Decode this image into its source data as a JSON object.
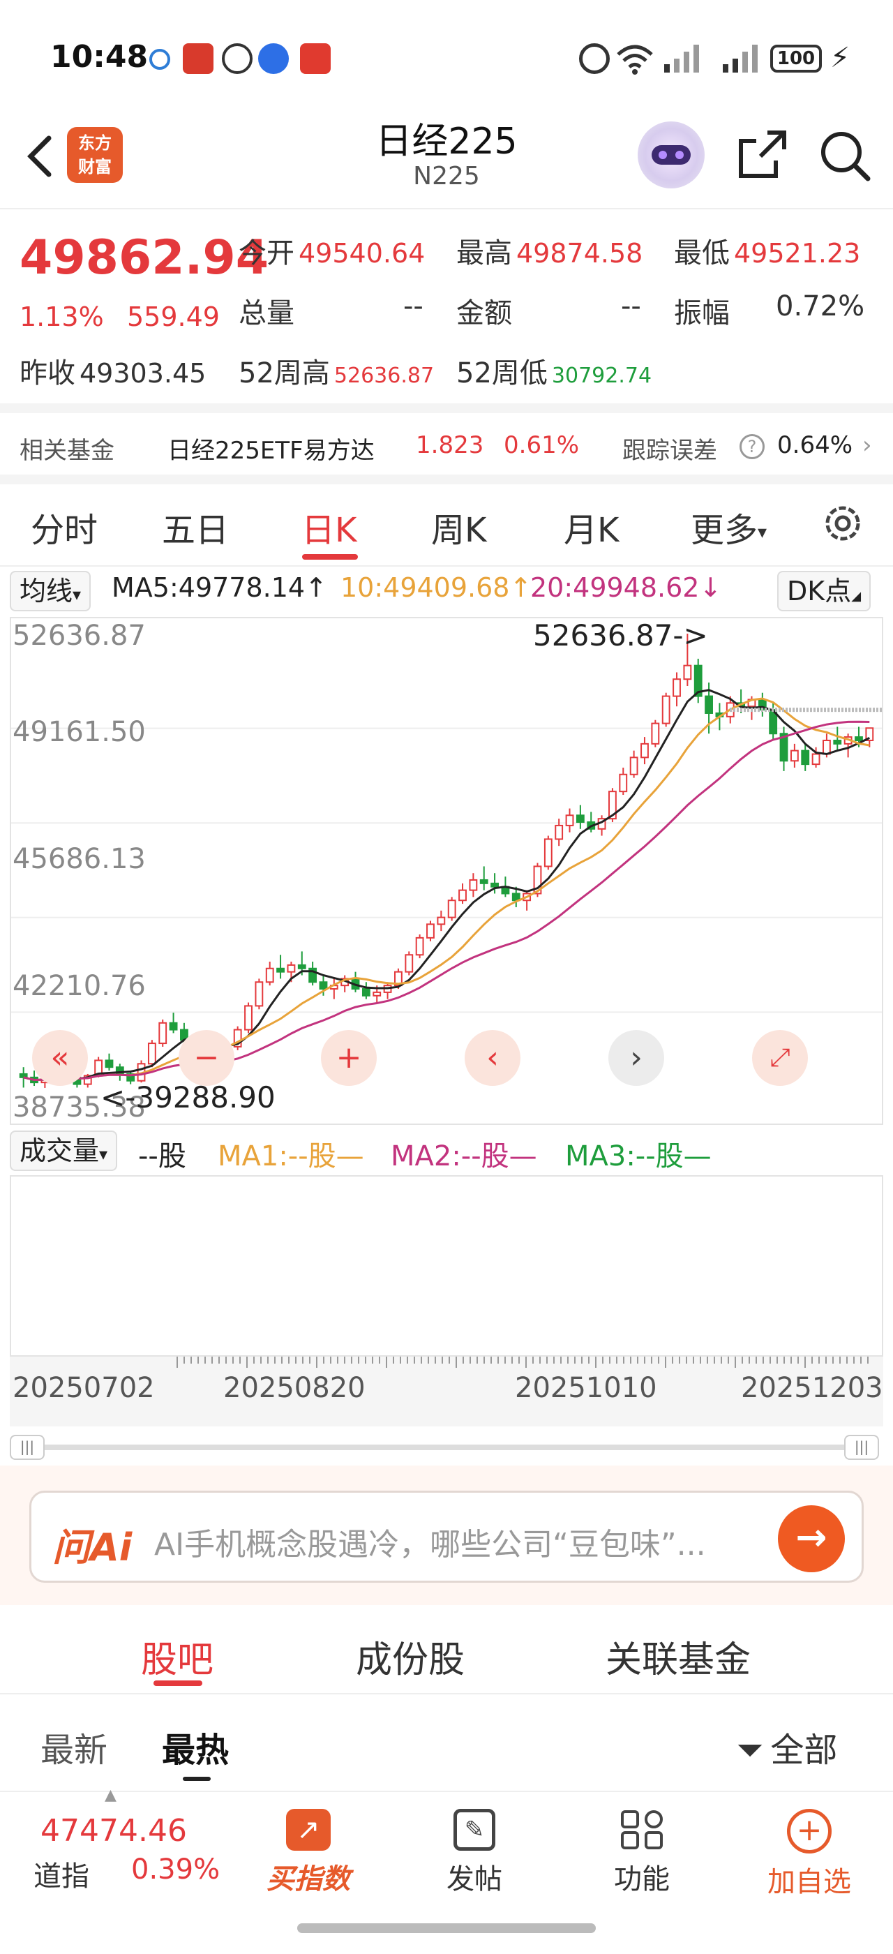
{
  "status_bar": {
    "time": "10:48",
    "battery": "100"
  },
  "nav": {
    "title": "日经225",
    "subtitle": "N225",
    "logo": "东方财富"
  },
  "quote": {
    "price": "49862.94",
    "change_pct": "1.13%",
    "change_abs": "559.49",
    "open_label": "今开",
    "open_value": "49540.64",
    "high_label": "最高",
    "high_value": "49874.58",
    "low_label": "最低",
    "low_value": "49521.23",
    "volume_label": "总量",
    "volume_value": "--",
    "amount_label": "金额",
    "amount_value": "--",
    "amplitude_label": "振幅",
    "amplitude_value": "0.72%",
    "prev_close_label": "昨收",
    "prev_close_value": "49303.45",
    "high52_label": "52周高",
    "high52_value": "52636.87",
    "low52_label": "52周低",
    "low52_value": "30792.74"
  },
  "fund": {
    "label": "相关基金",
    "name": "日经225ETF易方达",
    "price": "1.823",
    "pct": "0.61%",
    "tracking_label": "跟踪误差",
    "tracking_value": "0.64%"
  },
  "tabs": [
    {
      "label": "分时"
    },
    {
      "label": "五日"
    },
    {
      "label": "日K"
    },
    {
      "label": "周K"
    },
    {
      "label": "月K"
    },
    {
      "label": "更多"
    }
  ],
  "ma_row": {
    "selector": "均线",
    "ma5": "MA5:49778.14↑",
    "ma10": "10:49409.68↑",
    "ma20": "20:49948.62↓",
    "dk": "DK点"
  },
  "chart": {
    "y_labels": [
      "52636.87",
      "49161.50",
      "45686.13",
      "42210.76",
      "38735.38"
    ],
    "max_marker": "52636.87->",
    "min_marker": "<-39288.90"
  },
  "volume_row": {
    "selector": "成交量",
    "unit": "--股",
    "ma1": "MA1:--股—",
    "ma2": "MA2:--股—",
    "ma3": "MA3:--股—"
  },
  "x_labels": [
    "20250702",
    "20250820",
    "20251010",
    "20251203"
  ],
  "ai": {
    "logo": "问Ai",
    "prompt": "AI手机概念股遇冷，哪些公司“豆包味”..."
  },
  "bottom_tabs": [
    {
      "label": "股吧"
    },
    {
      "label": "成份股"
    },
    {
      "label": "关联基金"
    }
  ],
  "sub_tabs": {
    "latest": "最新",
    "hot": "最热",
    "filter": "全部"
  },
  "bottom_nav": {
    "index_value": "47474.46",
    "index_name": "道指",
    "index_pct": "0.39%",
    "buy_index": "买指数",
    "post": "发帖",
    "features": "功能",
    "add_watch": "加自选"
  },
  "chart_data": {
    "type": "candlestick",
    "ylim": [
      38735.38,
      52636.87
    ],
    "series": [
      {
        "name": "MA5",
        "color": "#222222"
      },
      {
        "name": "MA10",
        "color": "#e8a33a"
      },
      {
        "name": "MA20",
        "color": "#c2337e"
      }
    ],
    "candles": [
      [
        39700,
        39900,
        39300,
        39600
      ],
      [
        39600,
        39800,
        39350,
        39450
      ],
      [
        39450,
        39700,
        39290,
        39550
      ],
      [
        39550,
        39900,
        39450,
        39800
      ],
      [
        39800,
        40000,
        39500,
        39600
      ],
      [
        39600,
        39750,
        39300,
        39400
      ],
      [
        39400,
        39700,
        39300,
        39650
      ],
      [
        39650,
        40200,
        39600,
        40100
      ],
      [
        40100,
        40300,
        39800,
        39900
      ],
      [
        39900,
        40000,
        39500,
        39700
      ],
      [
        39700,
        39800,
        39400,
        39500
      ],
      [
        39500,
        40100,
        39450,
        40000
      ],
      [
        40000,
        40700,
        39900,
        40600
      ],
      [
        40600,
        41300,
        40500,
        41200
      ],
      [
        41200,
        41500,
        40900,
        41000
      ],
      [
        41000,
        41200,
        40600,
        40700
      ],
      [
        40700,
        40900,
        40400,
        40500
      ],
      [
        40500,
        40800,
        40300,
        40600
      ],
      [
        40600,
        40700,
        40100,
        40300
      ],
      [
        40300,
        40600,
        40200,
        40500
      ],
      [
        40500,
        41100,
        40400,
        41000
      ],
      [
        41000,
        41800,
        40900,
        41700
      ],
      [
        41700,
        42500,
        41600,
        42400
      ],
      [
        42400,
        43000,
        42300,
        42800
      ],
      [
        42800,
        43200,
        42500,
        42700
      ],
      [
        42700,
        43000,
        42400,
        42900
      ],
      [
        42900,
        43300,
        42600,
        42800
      ],
      [
        42800,
        43000,
        42300,
        42400
      ],
      [
        42400,
        42600,
        42000,
        42200
      ],
      [
        42200,
        42500,
        41900,
        42300
      ],
      [
        42300,
        42600,
        42100,
        42500
      ],
      [
        42500,
        42700,
        42100,
        42200
      ],
      [
        42200,
        42400,
        41900,
        42000
      ],
      [
        42000,
        42300,
        41800,
        42100
      ],
      [
        42100,
        42400,
        41900,
        42300
      ],
      [
        42300,
        42800,
        42200,
        42700
      ],
      [
        42700,
        43300,
        42600,
        43200
      ],
      [
        43200,
        43800,
        43100,
        43700
      ],
      [
        43700,
        44200,
        43600,
        44100
      ],
      [
        44100,
        44500,
        43900,
        44300
      ],
      [
        44300,
        44900,
        44200,
        44800
      ],
      [
        44800,
        45300,
        44700,
        45100
      ],
      [
        45100,
        45600,
        44900,
        45400
      ],
      [
        45400,
        45800,
        45100,
        45300
      ],
      [
        45300,
        45600,
        45000,
        45200
      ],
      [
        45200,
        45500,
        44900,
        45000
      ],
      [
        45000,
        45200,
        44600,
        44800
      ],
      [
        44800,
        45100,
        44500,
        45000
      ],
      [
        45000,
        45900,
        44900,
        45800
      ],
      [
        45800,
        46700,
        45700,
        46600
      ],
      [
        46600,
        47200,
        46400,
        47000
      ],
      [
        47000,
        47500,
        46800,
        47300
      ],
      [
        47300,
        47600,
        46900,
        47100
      ],
      [
        47100,
        47400,
        46800,
        46900
      ],
      [
        46900,
        47300,
        46700,
        47200
      ],
      [
        47200,
        48100,
        47100,
        48000
      ],
      [
        48000,
        48700,
        47900,
        48500
      ],
      [
        48500,
        49200,
        48400,
        49000
      ],
      [
        49000,
        49600,
        48800,
        49400
      ],
      [
        49400,
        50100,
        49300,
        50000
      ],
      [
        50000,
        50900,
        49900,
        50800
      ],
      [
        50800,
        51500,
        50500,
        51300
      ],
      [
        51300,
        52637,
        51100,
        51700
      ],
      [
        51700,
        51900,
        50600,
        50800
      ],
      [
        50800,
        51200,
        49700,
        50300
      ],
      [
        50300,
        50600,
        49800,
        50200
      ],
      [
        50200,
        50800,
        50000,
        50600
      ],
      [
        50600,
        51000,
        50300,
        50500
      ],
      [
        50500,
        50800,
        50100,
        50700
      ],
      [
        50700,
        50900,
        50200,
        50400
      ],
      [
        50400,
        50600,
        49500,
        49700
      ],
      [
        49700,
        49900,
        48600,
        48900
      ],
      [
        48900,
        49400,
        48700,
        49200
      ],
      [
        49200,
        49400,
        48600,
        48800
      ],
      [
        48800,
        49300,
        48700,
        49100
      ],
      [
        49100,
        49700,
        49000,
        49500
      ],
      [
        49500,
        49900,
        49200,
        49400
      ],
      [
        49400,
        49700,
        49000,
        49600
      ],
      [
        49600,
        49900,
        49300,
        49500
      ],
      [
        49500,
        49874,
        49300,
        49863
      ]
    ]
  }
}
